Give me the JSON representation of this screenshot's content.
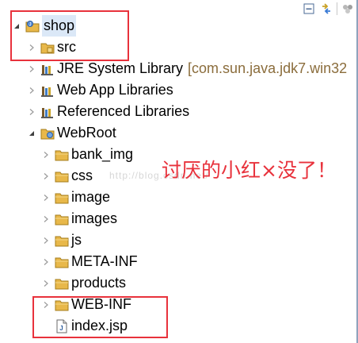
{
  "tree": {
    "items": [
      {
        "label": "shop",
        "icon": "project-icon",
        "expanded": true,
        "selected": true
      },
      {
        "label": "src",
        "icon": "source-folder-icon",
        "expanded": false
      },
      {
        "label": "JRE System Library",
        "decoration": "[com.sun.java.jdk7.win32",
        "icon": "library-icon",
        "expanded": false
      },
      {
        "label": "Web App Libraries",
        "icon": "library-icon",
        "expanded": false
      },
      {
        "label": "Referenced Libraries",
        "icon": "library-icon",
        "expanded": false
      },
      {
        "label": "WebRoot",
        "icon": "web-folder-icon",
        "expanded": true
      },
      {
        "label": "bank_img",
        "icon": "folder-icon",
        "expanded": false
      },
      {
        "label": "css",
        "icon": "folder-icon",
        "expanded": false
      },
      {
        "label": "image",
        "icon": "folder-icon",
        "expanded": false
      },
      {
        "label": "images",
        "icon": "folder-icon",
        "expanded": false
      },
      {
        "label": "js",
        "icon": "folder-icon",
        "expanded": false
      },
      {
        "label": "META-INF",
        "icon": "folder-icon",
        "expanded": false
      },
      {
        "label": "products",
        "icon": "folder-icon",
        "expanded": false
      },
      {
        "label": "WEB-INF",
        "icon": "folder-icon",
        "expanded": false
      },
      {
        "label": "index.jsp",
        "icon": "jsp-file-icon"
      }
    ]
  },
  "toolbar": {
    "icons": [
      "collapse-all-icon",
      "link-with-editor-icon",
      "view-menu-icon"
    ]
  },
  "annotation": {
    "text": "讨厌的小红×没了！",
    "watermark": "http://blog.csdn.net/"
  },
  "colors": {
    "highlight": "#e8323c",
    "selection": "#dbe8f7",
    "folder": "#e8b84a",
    "decoration": "#8b6d3c"
  }
}
